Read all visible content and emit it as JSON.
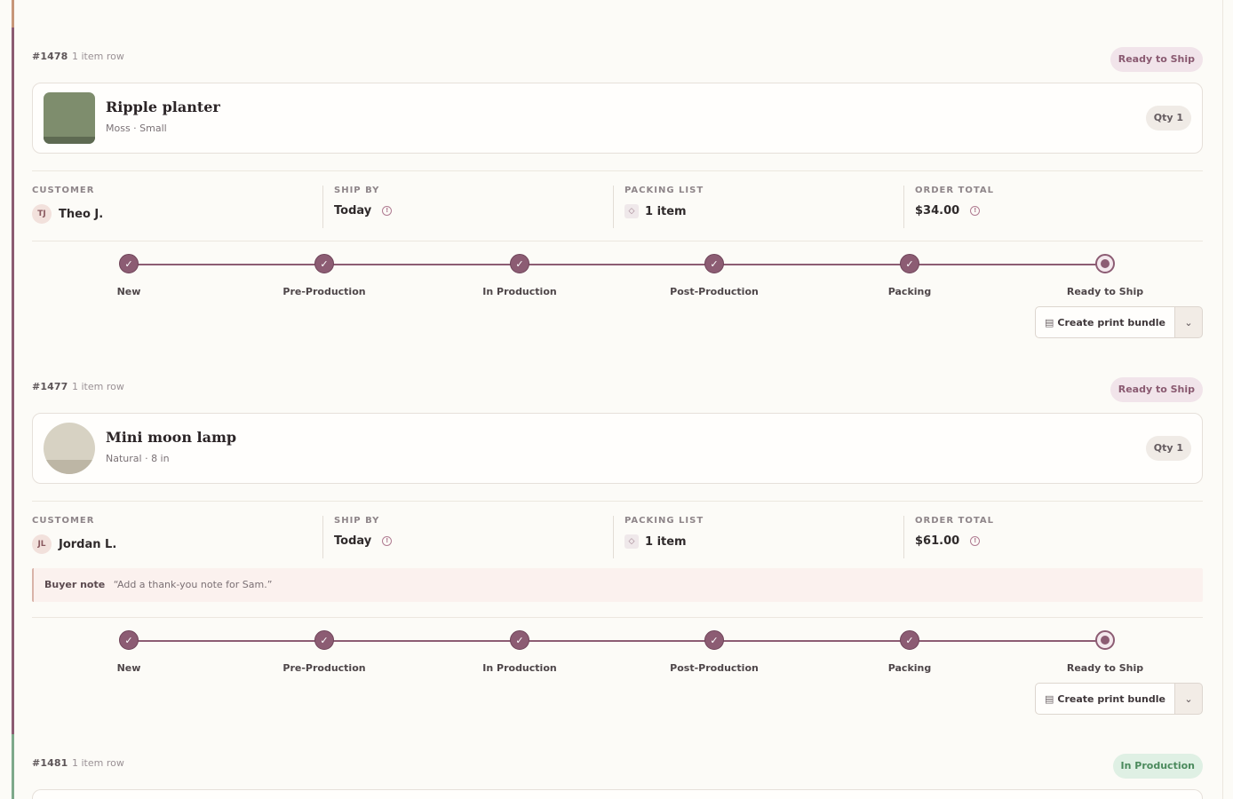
{
  "colors": {
    "accent": "#8c5c73",
    "ready_pill_bg": "#f1e4ea",
    "production_pill_bg": "#dff0e4",
    "production_pill_text": "#4b8a5d"
  },
  "steps": [
    "New",
    "Pre-Production",
    "In Production",
    "Post-Production",
    "Packing",
    "Ready to Ship"
  ],
  "orders": [
    {
      "id": "#1478",
      "rows": "1 item row",
      "status": "Ready to Ship",
      "item": {
        "name": "Ripple planter",
        "variant": "Moss · Small",
        "qty": "Qty 1"
      },
      "meta": {
        "customer_label": "CUSTOMER",
        "initials": "TJ",
        "customer": "Theo J.",
        "ship_label": "SHIP BY",
        "ship": "Today",
        "packing_label": "PACKING LIST",
        "packing": "1 item",
        "total_label": "ORDER TOTAL",
        "total": "$34.00"
      },
      "progress_completed": 5,
      "bundle_label": "Create print bundle"
    },
    {
      "id": "#1477",
      "rows": "1 item row",
      "status": "Ready to Ship",
      "item": {
        "name": "Mini moon lamp",
        "variant": "Natural · 8 in",
        "qty": "Qty 1"
      },
      "meta": {
        "customer_label": "CUSTOMER",
        "initials": "JL",
        "customer": "Jordan L.",
        "ship_label": "SHIP BY",
        "ship": "Today",
        "packing_label": "PACKING LIST",
        "packing": "1 item",
        "total_label": "ORDER TOTAL",
        "total": "$61.00"
      },
      "note_label": "Buyer note",
      "note": "“Add a thank-you note for Sam.”",
      "progress_completed": 5,
      "bundle_label": "Create print bundle"
    },
    {
      "id": "#1481",
      "rows": "1 item row",
      "status": "In Production"
    }
  ],
  "icons": {
    "check": "✓",
    "info": "!",
    "packing": "◇",
    "bundle": "▤",
    "caret": "⌄"
  }
}
